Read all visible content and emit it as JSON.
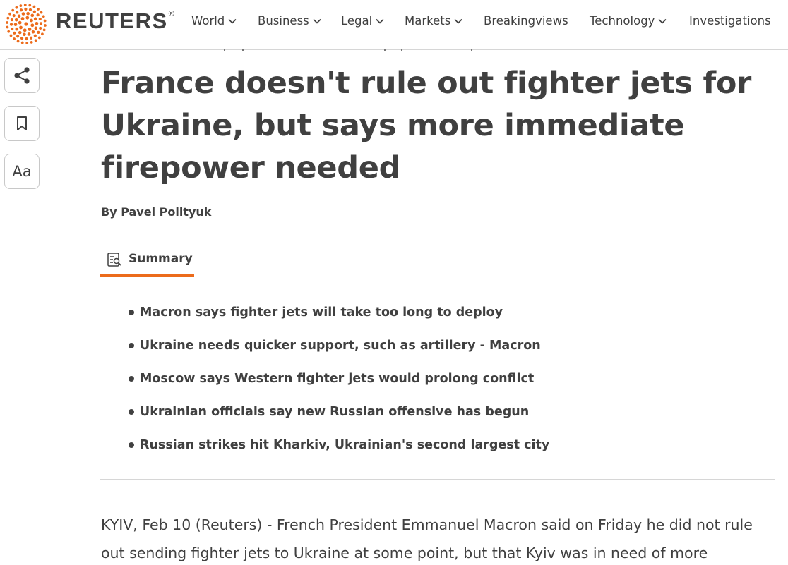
{
  "header": {
    "brand": "REUTERS",
    "trademark": "®",
    "logo_icon": "reuters-dot-logo-icon",
    "accent_color": "#ec6b1b",
    "nav": [
      {
        "label": "World",
        "has_dropdown": true
      },
      {
        "label": "Business",
        "has_dropdown": true
      },
      {
        "label": "Legal",
        "has_dropdown": true
      },
      {
        "label": "Markets",
        "has_dropdown": true
      },
      {
        "label": "Breakingviews",
        "has_dropdown": false
      },
      {
        "label": "Technology",
        "has_dropdown": true
      },
      {
        "label": "Investigations",
        "has_dropdown": false
      }
    ]
  },
  "tools": {
    "share_icon": "share-icon",
    "bookmark_icon": "bookmark-icon",
    "text_size_label": "Aa"
  },
  "article": {
    "headline": "France doesn't rule out fighter jets for Ukraine, but says more immediate firepower needed",
    "byline": "By Pavel Polityuk",
    "summary_tab": "Summary",
    "summary_icon": "summary-document-icon",
    "summary_points": [
      "Macron says fighter jets will take too long to deploy",
      "Ukraine needs quicker support, such as artillery - Macron",
      "Moscow says Western fighter jets would prolong conflict",
      "Ukrainian officials say new Russian offensive has begun",
      "Russian strikes hit Kharkiv, Ukrainian's second largest city"
    ],
    "body_text": "KYIV, Feb 10 (Reuters) - French President Emmanuel Macron said on Friday he did not rule out sending fighter jets to Ukraine at some point, but that Kyiv was in need of more"
  }
}
